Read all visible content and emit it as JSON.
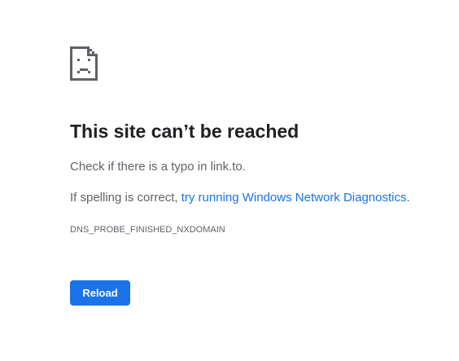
{
  "icon": "sad-page-icon",
  "title": "This site can’t be reached",
  "message": {
    "line1": "Check if there is a typo in link.to.",
    "line2_prefix": "If spelling is correct, ",
    "line2_link": "try running Windows Network Diagnostics",
    "line2_suffix": "."
  },
  "error_code": "DNS_PROBE_FINISHED_NXDOMAIN",
  "reload_button": "Reload",
  "colors": {
    "title": "#202124",
    "body_text": "#5f6368",
    "link": "#1a73e8",
    "button_bg": "#1a73e8",
    "button_text": "#ffffff"
  }
}
